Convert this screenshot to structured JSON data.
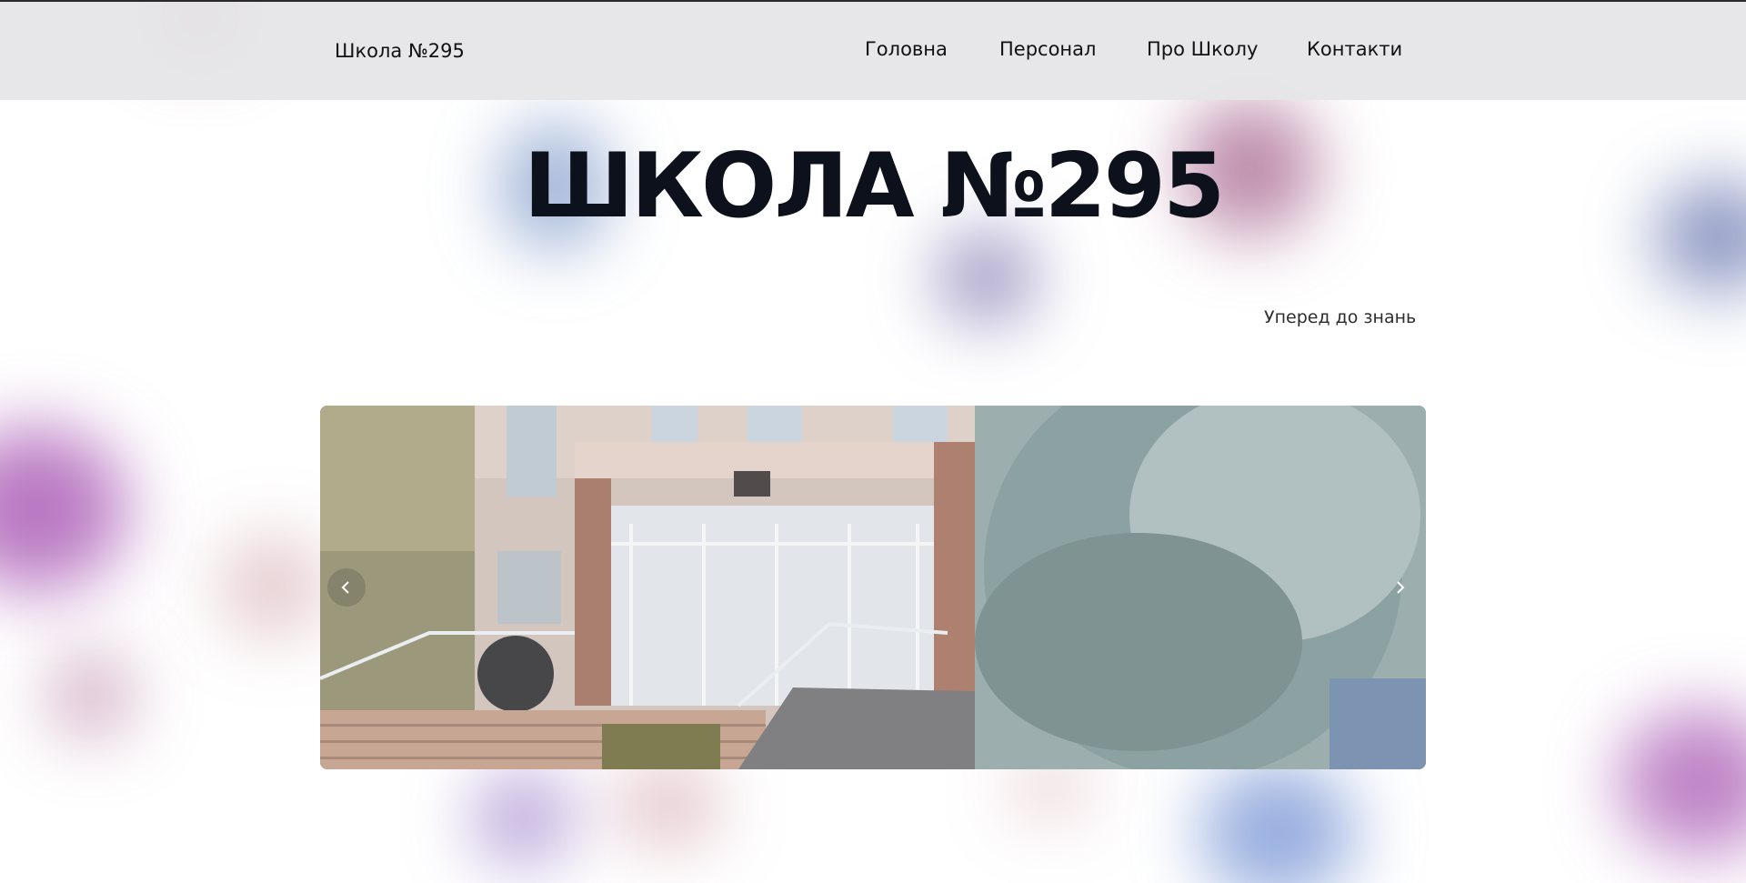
{
  "navbar": {
    "brand": "Школа №295",
    "links": [
      {
        "label": "Головна"
      },
      {
        "label": "Персонал"
      },
      {
        "label": "Про Школу"
      },
      {
        "label": "Контакти"
      }
    ]
  },
  "hero": {
    "title": "ШКОЛА №295",
    "subtitle": "Уперед до знань"
  },
  "carousel": {
    "prev_icon": "chevron-left-icon",
    "next_icon": "chevron-right-icon",
    "image": "school-entrance-photo"
  },
  "colors": {
    "navbar_bg": "#e5e5e7",
    "title_color": "#0c111b",
    "blob_colors": [
      "#8e3a6e",
      "#4a6fb5",
      "#5a4f9a",
      "#9b3fa8",
      "#b06070",
      "#7a54b8",
      "#4e74c8"
    ]
  }
}
